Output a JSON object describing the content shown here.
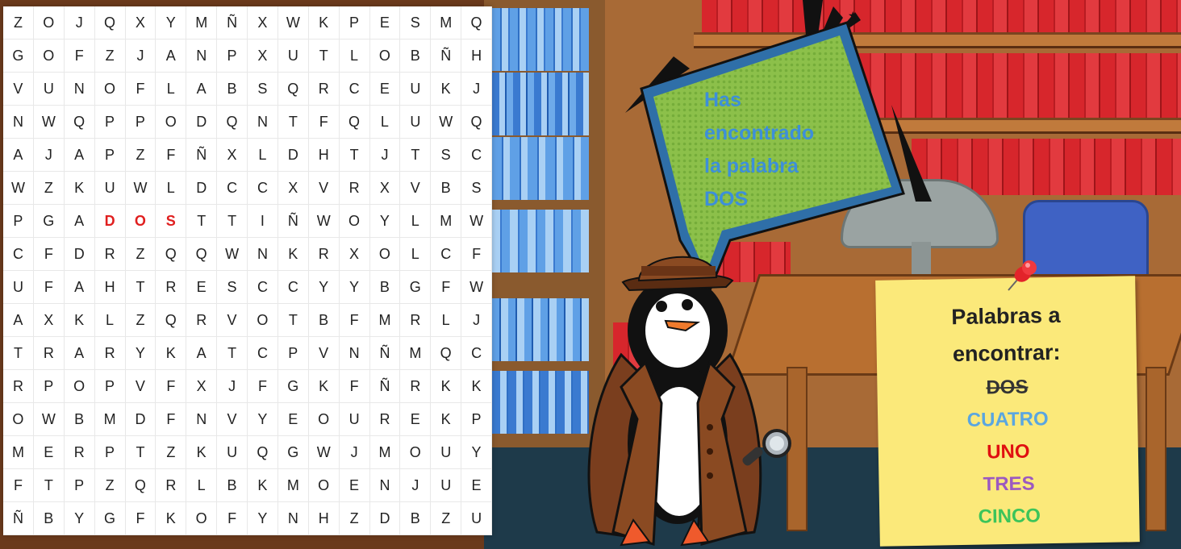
{
  "grid": [
    [
      "Z",
      "O",
      "J",
      "Q",
      "X",
      "Y",
      "M",
      "Ñ",
      "X",
      "W",
      "K",
      "P",
      "E",
      "S",
      "M",
      "Q"
    ],
    [
      "G",
      "O",
      "F",
      "Z",
      "J",
      "A",
      "N",
      "P",
      "X",
      "U",
      "T",
      "L",
      "O",
      "B",
      "Ñ",
      "H"
    ],
    [
      "V",
      "U",
      "N",
      "O",
      "F",
      "L",
      "A",
      "B",
      "S",
      "Q",
      "R",
      "C",
      "E",
      "U",
      "K",
      "J"
    ],
    [
      "N",
      "W",
      "Q",
      "P",
      "P",
      "O",
      "D",
      "Q",
      "N",
      "T",
      "F",
      "Q",
      "L",
      "U",
      "W",
      "Q"
    ],
    [
      "A",
      "J",
      "A",
      "P",
      "Z",
      "F",
      "Ñ",
      "X",
      "L",
      "D",
      "H",
      "T",
      "J",
      "T",
      "S",
      "C"
    ],
    [
      "W",
      "Z",
      "K",
      "U",
      "W",
      "L",
      "D",
      "C",
      "C",
      "X",
      "V",
      "R",
      "X",
      "V",
      "B",
      "S"
    ],
    [
      "P",
      "G",
      "A",
      "D",
      "O",
      "S",
      "T",
      "T",
      "I",
      "Ñ",
      "W",
      "O",
      "Y",
      "L",
      "M",
      "W"
    ],
    [
      "C",
      "F",
      "D",
      "R",
      "Z",
      "Q",
      "Q",
      "W",
      "N",
      "K",
      "R",
      "X",
      "O",
      "L",
      "C",
      "F"
    ],
    [
      "U",
      "F",
      "A",
      "H",
      "T",
      "R",
      "E",
      "S",
      "C",
      "C",
      "Y",
      "Y",
      "B",
      "G",
      "F",
      "W"
    ],
    [
      "A",
      "X",
      "K",
      "L",
      "Z",
      "Q",
      "R",
      "V",
      "O",
      "T",
      "B",
      "F",
      "M",
      "R",
      "L",
      "J"
    ],
    [
      "T",
      "R",
      "A",
      "R",
      "Y",
      "K",
      "A",
      "T",
      "C",
      "P",
      "V",
      "N",
      "Ñ",
      "M",
      "Q",
      "C"
    ],
    [
      "R",
      "P",
      "O",
      "P",
      "V",
      "F",
      "X",
      "J",
      "F",
      "G",
      "K",
      "F",
      "Ñ",
      "R",
      "K",
      "K"
    ],
    [
      "O",
      "W",
      "B",
      "M",
      "D",
      "F",
      "N",
      "V",
      "Y",
      "E",
      "O",
      "U",
      "R",
      "E",
      "K",
      "P"
    ],
    [
      "M",
      "E",
      "R",
      "P",
      "T",
      "Z",
      "K",
      "U",
      "Q",
      "G",
      "W",
      "J",
      "M",
      "O",
      "U",
      "Y"
    ],
    [
      "F",
      "T",
      "P",
      "Z",
      "Q",
      "R",
      "L",
      "B",
      "K",
      "M",
      "O",
      "E",
      "N",
      "J",
      "U",
      "E"
    ],
    [
      "Ñ",
      "B",
      "Y",
      "G",
      "F",
      "K",
      "O",
      "F",
      "Y",
      "N",
      "H",
      "Z",
      "D",
      "B",
      "Z",
      "U"
    ]
  ],
  "found_cells": [
    [
      6,
      3
    ],
    [
      6,
      4
    ],
    [
      6,
      5
    ]
  ],
  "found_color": "#e01f1f",
  "bubble": {
    "line1": "Has",
    "line2": "encontrado",
    "line3": "la palabra",
    "line4": "DOS",
    "text_color": "#3d8fd9",
    "fill_color": "#8cc04a",
    "border_color": "#2f6fa8"
  },
  "note": {
    "title_line1": "Palabras a",
    "title_line2": "encontrar:",
    "words": [
      {
        "text": "DOS",
        "color": "#333333",
        "found": true
      },
      {
        "text": "CUATRO",
        "color": "#5aa6e0",
        "found": false
      },
      {
        "text": "UNO",
        "color": "#e01010",
        "found": false
      },
      {
        "text": "TRES",
        "color": "#9b59c0",
        "found": false
      },
      {
        "text": "CINCO",
        "color": "#3cc45a",
        "found": false
      }
    ]
  },
  "icons": {
    "pin": "pushpin-icon",
    "magnifier": "magnifying-glass-icon"
  }
}
